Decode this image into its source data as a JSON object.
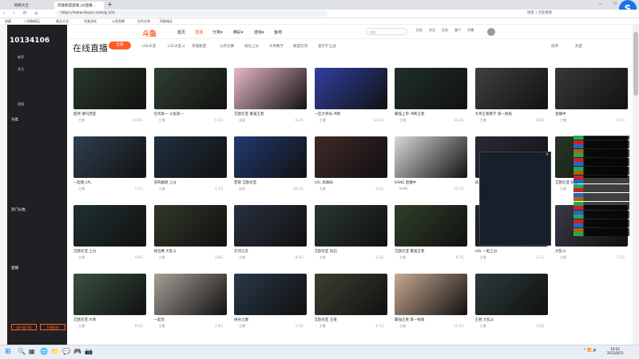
{
  "browser": {
    "tabs": [
      {
        "label": "网络大全"
      },
      {
        "label": "英雄联盟直播_lol直播..."
      }
    ],
    "new_tab": "+",
    "window_controls": "— ☐ ✕",
    "url": "https://www.douyu.com/g_LOL",
    "addr_right": "搜索 | 点此搜索",
    "bookmarks": [
      "收藏",
      "二网聚精品",
      "精品大全",
      "完美游戏",
      "斗鱼直播",
      "优秀文章",
      "网聚精品"
    ],
    "avatar_letter": "S"
  },
  "sidebar": {
    "room_no": "10134106",
    "items": [
      "推荐",
      "关注",
      "视频",
      "",
      "分类",
      "",
      "热门分类",
      "",
      "直播"
    ],
    "footer_buttons": [
      "客户端下载",
      "开播指南"
    ]
  },
  "header": {
    "logo": "斗鱼",
    "nav": [
      "首页",
      "直播",
      "分类▾",
      "精彩▾",
      "游戏▾",
      "鱼吧"
    ],
    "search_placeholder": "搜索",
    "icons": [
      "历史",
      "关注",
      "任务",
      "客户",
      "开播"
    ]
  },
  "content": {
    "title": "在线直播",
    "active_category": "全部",
    "categories": [
      "LOL水友",
      "LOL大乱斗",
      "英雄联盟",
      "公开比赛",
      "排位上分",
      "大神教学",
      "联盟云顶",
      "金铲铲之战"
    ],
    "sort": "排序",
    "sort_hot": "热度"
  },
  "cards": [
    {
      "title": "超神 德玛西亚",
      "anchor": "主播",
      "heat": "14.8万",
      "color": "#2a3a2a"
    },
    {
      "title": "吃鸡第一 斗鱼第一",
      "anchor": "主播",
      "heat": "6.1万",
      "color": "#304030"
    },
    {
      "title": "艾欧尼亚 最强王者",
      "anchor": "温柔",
      "heat": "8.2万",
      "color": "#e8b8c8"
    },
    {
      "title": "一区大师局 冲刺",
      "anchor": "主播",
      "heat": "12.4万",
      "color": "#3040a0"
    },
    {
      "title": "最强上单 冲刺王者",
      "anchor": "主播",
      "heat": "10.2万",
      "color": "#203028"
    },
    {
      "title": "大师王者教学 第一视角",
      "anchor": "主播",
      "heat": "9.8万",
      "color": "#404040"
    },
    {
      "title": "直播中",
      "anchor": "主播",
      "heat": "5.2万",
      "color": "#383838"
    },
    {
      "title": "一起看 LPL",
      "anchor": "主播",
      "heat": "7.1万",
      "color": "#2e4050"
    },
    {
      "title": "逆风翻盘 上分",
      "anchor": "主播",
      "heat": "4.3万",
      "color": "#203040"
    },
    {
      "title": "若雨 艾欧尼亚",
      "anchor": "若雨",
      "heat": "16.5万",
      "color": "#203a70"
    },
    {
      "title": "LOL 高端局",
      "anchor": "主播",
      "heat": "3.4万",
      "color": "#402828"
    },
    {
      "title": "KANE 直播中",
      "anchor": "KANE",
      "heat": "13.7万",
      "color": "#d8d8d8"
    },
    {
      "title": "高分段 教学",
      "anchor": "主播",
      "heat": "6.6万",
      "color": "#2a2a3a"
    },
    {
      "title": "艾欧尼亚 钻石",
      "anchor": "主播",
      "heat": "5.5万",
      "color": "#283828"
    },
    {
      "title": "艾欧尼亚 上分",
      "anchor": "主播",
      "heat": "4.9万",
      "color": "#203030"
    },
    {
      "title": "排位赛 大乱斗",
      "anchor": "主播",
      "heat": "2.8万",
      "color": "#303828"
    },
    {
      "title": "云顶之弈",
      "anchor": "主播",
      "heat": "8.0万",
      "color": "#283040"
    },
    {
      "title": "艾欧尼亚 钻石",
      "anchor": "主播",
      "heat": "3.2万",
      "color": "#2a3830"
    },
    {
      "title": "艾欧尼亚 最强王者",
      "anchor": "主播",
      "heat": "6.7万",
      "color": "#304028"
    },
    {
      "title": "LOL 一起上分",
      "anchor": "主播",
      "heat": "2.1万",
      "color": "#202830"
    },
    {
      "title": "大乱斗",
      "anchor": "主播",
      "heat": "7.5万",
      "color": "#3a3a48"
    },
    {
      "title": "艾欧尼亚 大师",
      "anchor": "主播",
      "heat": "9.1万",
      "color": "#385040"
    },
    {
      "title": "一起玩",
      "anchor": "主播",
      "heat": "1.8万",
      "color": "#a8a098"
    },
    {
      "title": "峡谷之巅",
      "anchor": "主播",
      "heat": "5.9万",
      "color": "#283848"
    },
    {
      "title": "艾欧尼亚 王者",
      "anchor": "主播",
      "heat": "4.7万",
      "color": "#3a4030"
    },
    {
      "title": "最强王者 第一视角",
      "anchor": "主播",
      "heat": "11.0万",
      "color": "#c8a890"
    },
    {
      "title": "王者 大乱斗",
      "anchor": "主播",
      "heat": "3.6万",
      "color": "#2a3a3a"
    }
  ],
  "taskbar": {
    "start": "⊞",
    "icons": [
      "🔍",
      "▦",
      "🌐",
      "📁",
      "💬",
      "🎮",
      "📷"
    ],
    "time": "19:02",
    "date": "2022/8/25",
    "tray": "^ 📶 🔊"
  },
  "overlay": {
    "lines": [
      "",
      "",
      "",
      "",
      "",
      ""
    ]
  },
  "popup": {
    "title": "",
    "close": "✕"
  },
  "colors": {
    "accent": "#ff5d23",
    "sidebar": "#1f1f24"
  }
}
